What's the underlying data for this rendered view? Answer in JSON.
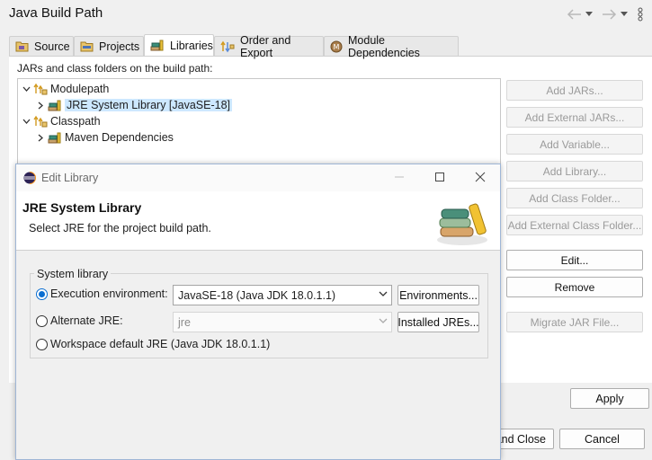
{
  "window": {
    "title": "Java Build Path"
  },
  "tabs": [
    {
      "label": "Source",
      "icon": "source-folder-icon"
    },
    {
      "label": "Projects",
      "icon": "projects-icon"
    },
    {
      "label": "Libraries",
      "icon": "libraries-icon",
      "active": true
    },
    {
      "label": "Order and Export",
      "icon": "order-export-icon"
    },
    {
      "label": "Module Dependencies",
      "icon": "module-icon"
    }
  ],
  "libraries": {
    "description": "JARs and class folders on the build path:",
    "tree": [
      {
        "label": "Modulepath",
        "expanded": true
      },
      {
        "label": "JRE System Library [JavaSE-18]",
        "selected": true
      },
      {
        "label": "Classpath",
        "expanded": true
      },
      {
        "label": "Maven Dependencies"
      }
    ],
    "buttons": {
      "add_jars": "Add JARs...",
      "add_external_jars": "Add External JARs...",
      "add_variable": "Add Variable...",
      "add_library": "Add Library...",
      "add_class_folder": "Add Class Folder...",
      "add_external_class_folder": "Add External Class Folder...",
      "edit": "Edit...",
      "remove": "Remove",
      "migrate_jar": "Migrate JAR File..."
    }
  },
  "footer": {
    "apply": "Apply",
    "apply_and_close": "and Close",
    "cancel": "Cancel"
  },
  "dialog": {
    "title": "Edit Library",
    "heading": "JRE System Library",
    "message": "Select JRE for the project build path.",
    "group_label": "System library",
    "options": {
      "execution_env": {
        "label": "Execution environment:",
        "selected": true
      },
      "alternate_jre": {
        "label": "Alternate JRE:",
        "selected": false
      },
      "workspace_default": {
        "label": "Workspace default JRE (Java JDK 18.0.1.1)",
        "selected": false
      }
    },
    "execution_env_value": "JavaSE-18 (Java JDK 18.0.1.1)",
    "alternate_jre_value": "jre",
    "environments_button": "Environments...",
    "installed_jres_button": "Installed JREs..."
  },
  "colors": {
    "accent": "#0b6ed1",
    "selection": "#cde8ff",
    "disabled_text": "#9a9a9a"
  }
}
